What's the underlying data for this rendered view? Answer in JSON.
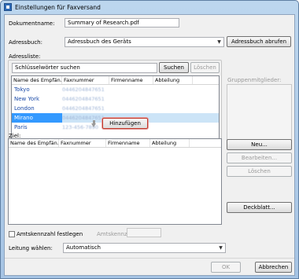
{
  "window": {
    "title": "Einstellungen für Faxversand"
  },
  "document_name": {
    "label": "Dokumentname:",
    "value": "Summary of Research.pdf"
  },
  "address_book": {
    "label": "Adressbuch:",
    "selected": "Adressbuch des Geräts",
    "fetch_button": "Adressbuch abrufen"
  },
  "address_list": {
    "label": "Adressliste:",
    "search_placeholder": "Schlüsselwörter suchen",
    "search_button": "Suchen",
    "clear_button": "Löschen",
    "columns": [
      "Name des Empfän...",
      "Faxnummer",
      "Firmenname",
      "Abteilung"
    ],
    "rows": [
      {
        "name": "Tokyo",
        "fax": "0446204847651"
      },
      {
        "name": "New York",
        "fax": "0446204847651"
      },
      {
        "name": "London",
        "fax": "0446204847651"
      },
      {
        "name": "Mirano",
        "fax": "0446204847651",
        "selected": true
      },
      {
        "name": "Paris",
        "fax": "123-456-7890"
      }
    ],
    "group_members_label": "Gruppenmitglieder:"
  },
  "add_button": "Hinzufügen",
  "destination": {
    "label": "Ziel:",
    "columns": [
      "Name des Empfän...",
      "Faxnummer",
      "Firmenname",
      "Abteilung"
    ],
    "new_button": "Neu...",
    "edit_button": "Bearbeiten...",
    "delete_button": "Löschen",
    "cover_button": "Deckblatt..."
  },
  "outside_line": {
    "checkbox_label": "Amtskennzahl festlegen",
    "code_label": "Amtskennzahl:",
    "code_value": ""
  },
  "line_select": {
    "label": "Leitung wählen:",
    "selected": "Automatisch"
  },
  "footer": {
    "ok_button": "OK",
    "cancel_button": "Abbrechen"
  }
}
